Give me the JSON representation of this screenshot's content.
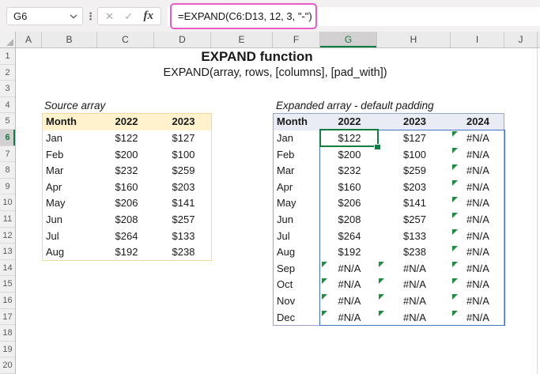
{
  "formula_bar": {
    "cell_reference": "G6",
    "formula": "=EXPAND(C6:D13, 12, 3, \"-\")",
    "fx_label": "fx",
    "icons": {
      "cancel": "✕",
      "enter": "✓",
      "more": "⋮"
    }
  },
  "sheet": {
    "column_headers": [
      "A",
      "B",
      "C",
      "D",
      "E",
      "F",
      "G",
      "H",
      "I",
      "J"
    ],
    "row_headers": [
      "1",
      "2",
      "3",
      "4",
      "5",
      "6",
      "7",
      "8",
      "9",
      "10",
      "11",
      "12",
      "13",
      "14",
      "15",
      "16",
      "17",
      "18",
      "19",
      "20"
    ],
    "selected_column": "G",
    "selected_row": "6",
    "title": "EXPAND function",
    "subtitle": "EXPAND(array, rows, [columns], [pad_with])"
  },
  "source_table": {
    "label": "Source array",
    "headers": [
      "Month",
      "2022",
      "2023"
    ],
    "rows": [
      [
        "Jan",
        "$122",
        "$127"
      ],
      [
        "Feb",
        "$200",
        "$100"
      ],
      [
        "Mar",
        "$232",
        "$259"
      ],
      [
        "Apr",
        "$160",
        "$203"
      ],
      [
        "May",
        "$206",
        "$141"
      ],
      [
        "Jun",
        "$208",
        "$257"
      ],
      [
        "Jul",
        "$264",
        "$133"
      ],
      [
        "Aug",
        "$192",
        "$238"
      ]
    ]
  },
  "expanded_table": {
    "label": "Expanded array - default padding",
    "headers": [
      "Month",
      "2022",
      "2023",
      "2024"
    ],
    "error_value": "#N/A",
    "selected_cell_reference": "G6",
    "rows": [
      [
        "Jan",
        "$122",
        "$127",
        "#N/A"
      ],
      [
        "Feb",
        "$200",
        "$100",
        "#N/A"
      ],
      [
        "Mar",
        "$232",
        "$259",
        "#N/A"
      ],
      [
        "Apr",
        "$160",
        "$203",
        "#N/A"
      ],
      [
        "May",
        "$206",
        "$141",
        "#N/A"
      ],
      [
        "Jun",
        "$208",
        "$257",
        "#N/A"
      ],
      [
        "Jul",
        "$264",
        "$133",
        "#N/A"
      ],
      [
        "Aug",
        "$192",
        "$238",
        "#N/A"
      ],
      [
        "Sep",
        "#N/A",
        "#N/A",
        "#N/A"
      ],
      [
        "Oct",
        "#N/A",
        "#N/A",
        "#N/A"
      ],
      [
        "Nov",
        "#N/A",
        "#N/A",
        "#N/A"
      ],
      [
        "Dec",
        "#N/A",
        "#N/A",
        "#N/A"
      ]
    ]
  },
  "colors": {
    "formula_highlight": "#E95BC5",
    "selection_green": "#107C41",
    "spill_border_blue": "#4472C4",
    "error_indicator_green": "#1E8C41",
    "source_header_bg": "#FFF2CC",
    "source_border": "#F0D89E",
    "expanded_header_bg": "#E9EBF5",
    "expanded_border": "#98A6CE"
  }
}
